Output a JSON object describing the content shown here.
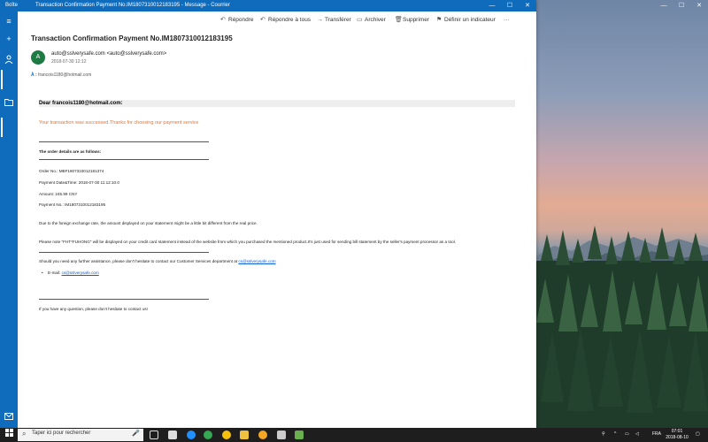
{
  "window": {
    "app_name": "Boîte",
    "title": "Transaction Confirmation Payment No.IM1807310012183195 - Message - Courrier",
    "controls": {
      "minimize": "—",
      "maximize": "☐",
      "close": "✕"
    }
  },
  "desktop_window": {
    "controls": {
      "minimize": "—",
      "maximize": "☐",
      "close": "✕"
    }
  },
  "toolbar": {
    "reply": "Répondre",
    "reply_all": "Répondre à tous",
    "forward": "Transférer",
    "archive": "Archiver",
    "delete": "Supprimer",
    "flag": "Définir un indicateur",
    "more": "···"
  },
  "message": {
    "subject": "Transaction Confirmation Payment No.IM1807310012183195",
    "avatar_letter": "A",
    "from": "auto@sslverysafe.com <auto@sslverysafe.com>",
    "date": "2018-07-30 12:12",
    "to_prefix": "À :",
    "to": "francois1180@hotmail.com"
  },
  "email_body": {
    "greeting": "Dear francois1180@hotmail.com:",
    "success": "Your transaction was successed.Thanks for choosing our payment service",
    "order_heading": "The order details are as follows:",
    "order_no": "Order No.: MBF1807310012181374",
    "payment_datetime": "Payment Date&Time: 2018-07-30 11:12:10.0",
    "amount": "Amount: 245.99 CNY",
    "payment_no": "Payment No.: IM1807310012183195",
    "exchange_note": "Due to the foreign exchange rate, the amount displayed on your statement might be a little bit different from the real price.",
    "statement_note": "Please note \"FHT*FUHONG\" will be displayed on your credit card statement instead of the website from which you purchased the mentioned product.It's just used for sending bill statement by the seller's payment processor as a tool.",
    "assistance_prefix": "Should you need any further assistance, please don't hesitate to contact our Customer Services department at",
    "assistance_email": "cs@sslverysafe.com",
    "email_label": "E-mail:",
    "email_link": "cs@sslverysafe.com",
    "closing": "If you have any question, please don't hesitate to contact us!"
  },
  "taskbar": {
    "search_placeholder": "Taper ici pour rechercher",
    "lang": "FRA",
    "time": "07:01",
    "date": "2018-08-10"
  }
}
